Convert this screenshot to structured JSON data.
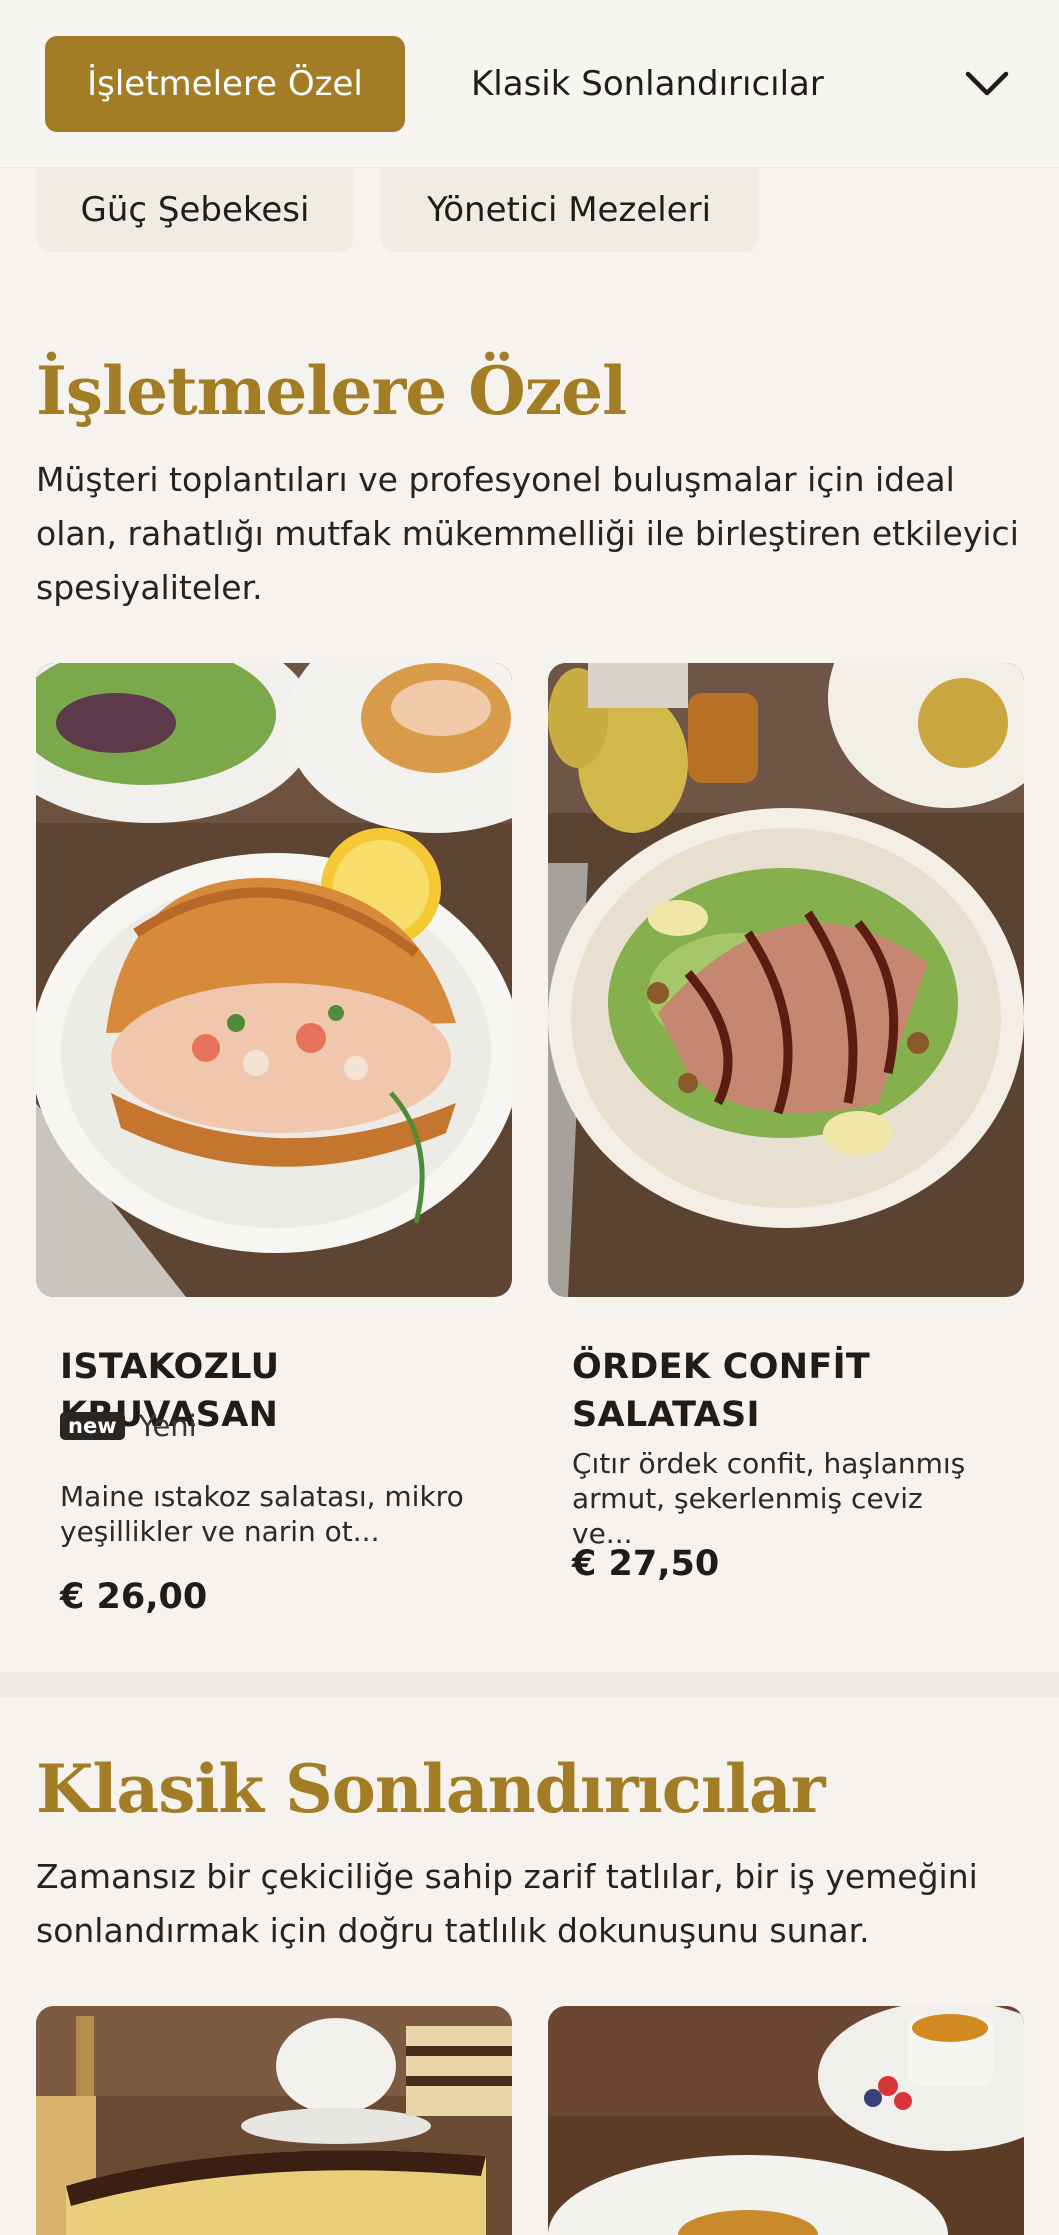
{
  "nav": {
    "active_tab": "İşletmelere Özel",
    "second_tab": "Klasik Sonlandırıcılar",
    "chips": [
      "Güç Şebekesi",
      "Yönetici Mezeleri"
    ]
  },
  "sections": [
    {
      "title": "İşletmelere Özel",
      "description": "Müşteri toplantıları ve profesyonel buluşmalar için ideal olan, rahatlığı mutfak mükemmelliği ile birleştiren etkileyici spesiyaliteler.",
      "products": [
        {
          "name": "ISTAKOZLU KRUVASAN",
          "badge": "new",
          "badge_label": "Yeni",
          "description": "Maine ıstakoz salatası, mikro yeşillikler ve narin ot...",
          "price": "€ 26,00",
          "image_icon": "lobster-croissant-photo"
        },
        {
          "name": "ÖRDEK CONFİT SALATASI",
          "description": "Çıtır ördek confit, haşlanmış armut, şekerlenmiş ceviz ve...",
          "price": "€ 27,50",
          "image_icon": "duck-confit-salad-photo"
        }
      ]
    },
    {
      "title": "Klasik Sonlandırıcılar",
      "description": "Zamansız bir çekiciliğe sahip zarif tatlılar, bir iş yemeğini sonlandırmak için doğru tatlılık dokunuşunu sunar.",
      "products": [
        {
          "image_icon": "layer-cake-photo"
        },
        {
          "image_icon": "creme-brulee-photo"
        }
      ]
    }
  ],
  "colors": {
    "accent": "#a27d25",
    "background": "#f6f3ee",
    "text": "#1f1c1a"
  }
}
